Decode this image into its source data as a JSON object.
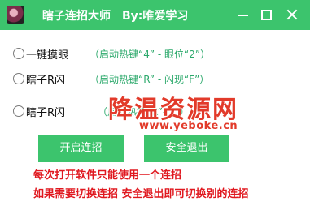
{
  "window": {
    "title": "瞎子连招大师　By:唯爱学习"
  },
  "options": [
    {
      "label": "一键摸眼",
      "hint": "（启动热键“4” - 眼位“2”）"
    },
    {
      "label": "瞎子R闪",
      "hint": "（启动热键“R” - 闪现“F”）"
    },
    {
      "label": "瞎子R闪",
      "hint": "（启动热键“R”-  “”）"
    }
  ],
  "buttons": {
    "start_label": "开启连招",
    "exit_label": "安全退出"
  },
  "notes": {
    "line1": "每次打开软件只能使用一个连招",
    "line2": "如果需要切换连招 安全退出即可切换别的连招"
  },
  "watermark": {
    "text": "降温资源网",
    "url": "www.yeboke.cn"
  },
  "colors": {
    "accent_green": "#3cc46d",
    "hint_green": "#2aa86a",
    "warning_red": "#e0181f"
  },
  "icons": {
    "app": "app-icon",
    "minimize": "minimize-icon",
    "maximize": "maximize-icon",
    "close": "close-icon"
  }
}
